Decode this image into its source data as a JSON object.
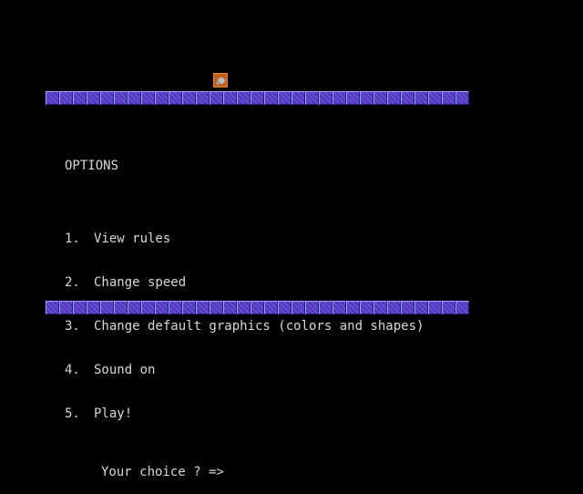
{
  "screen": {
    "background_color": "#000000",
    "text_color": "#d8d8d8",
    "wall_color": "#5a44c8",
    "sprite_color": "#c06018"
  },
  "sprite": {
    "icon": "player-sprite-icon"
  },
  "menu": {
    "title": "OPTIONS",
    "items": [
      {
        "number": "1.",
        "label": "View rules"
      },
      {
        "number": "2.",
        "label": "Change speed"
      },
      {
        "number": "3.",
        "label": "Change default graphics (colors and shapes)"
      },
      {
        "number": "4.",
        "label": "Sound on"
      },
      {
        "number": "5.",
        "label": "Play!"
      }
    ],
    "prompt": "Your choice ? =>"
  }
}
